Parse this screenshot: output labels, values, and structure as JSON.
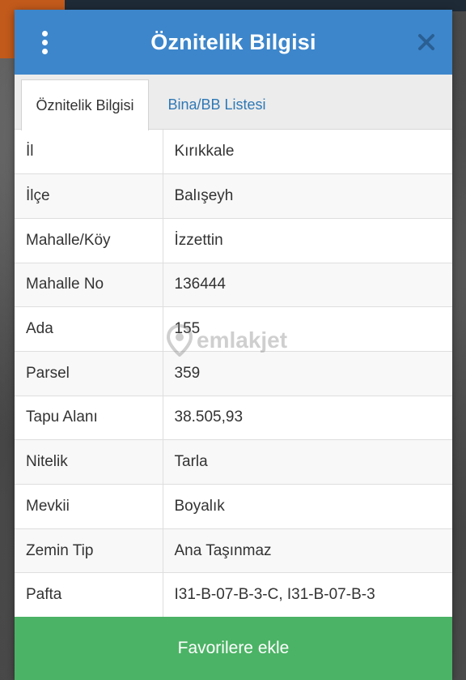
{
  "dialog": {
    "title": "Öznitelik Bilgisi",
    "close_symbol": "✕"
  },
  "tabs": [
    {
      "label": "Öznitelik Bilgisi",
      "active": true
    },
    {
      "label": "Bina/BB Listesi",
      "active": false
    }
  ],
  "attributes": [
    {
      "key": "İl",
      "value": "Kırıkkale"
    },
    {
      "key": "İlçe",
      "value": "Balışeyh"
    },
    {
      "key": "Mahalle/Köy",
      "value": "İzzettin"
    },
    {
      "key": "Mahalle No",
      "value": "136444"
    },
    {
      "key": "Ada",
      "value": "155"
    },
    {
      "key": "Parsel",
      "value": "359"
    },
    {
      "key": "Tapu Alanı",
      "value": "38.505,93"
    },
    {
      "key": "Nitelik",
      "value": "Tarla"
    },
    {
      "key": "Mevkii",
      "value": "Boyalık"
    },
    {
      "key": "Zemin Tip",
      "value": "Ana Taşınmaz"
    },
    {
      "key": "Pafta",
      "value": "I31-B-07-B-3-C, I31-B-07-B-3"
    }
  ],
  "watermark": {
    "text": "emlakjet"
  },
  "footer": {
    "favorite_label": "Favorilere ekle"
  },
  "icons": {
    "menu": "more-vertical-icon",
    "close": "close-icon",
    "watermark": "location-pin-icon"
  },
  "colors": {
    "header": "#3d86cb",
    "tab_link": "#2f78b5",
    "button": "#4bb365"
  }
}
